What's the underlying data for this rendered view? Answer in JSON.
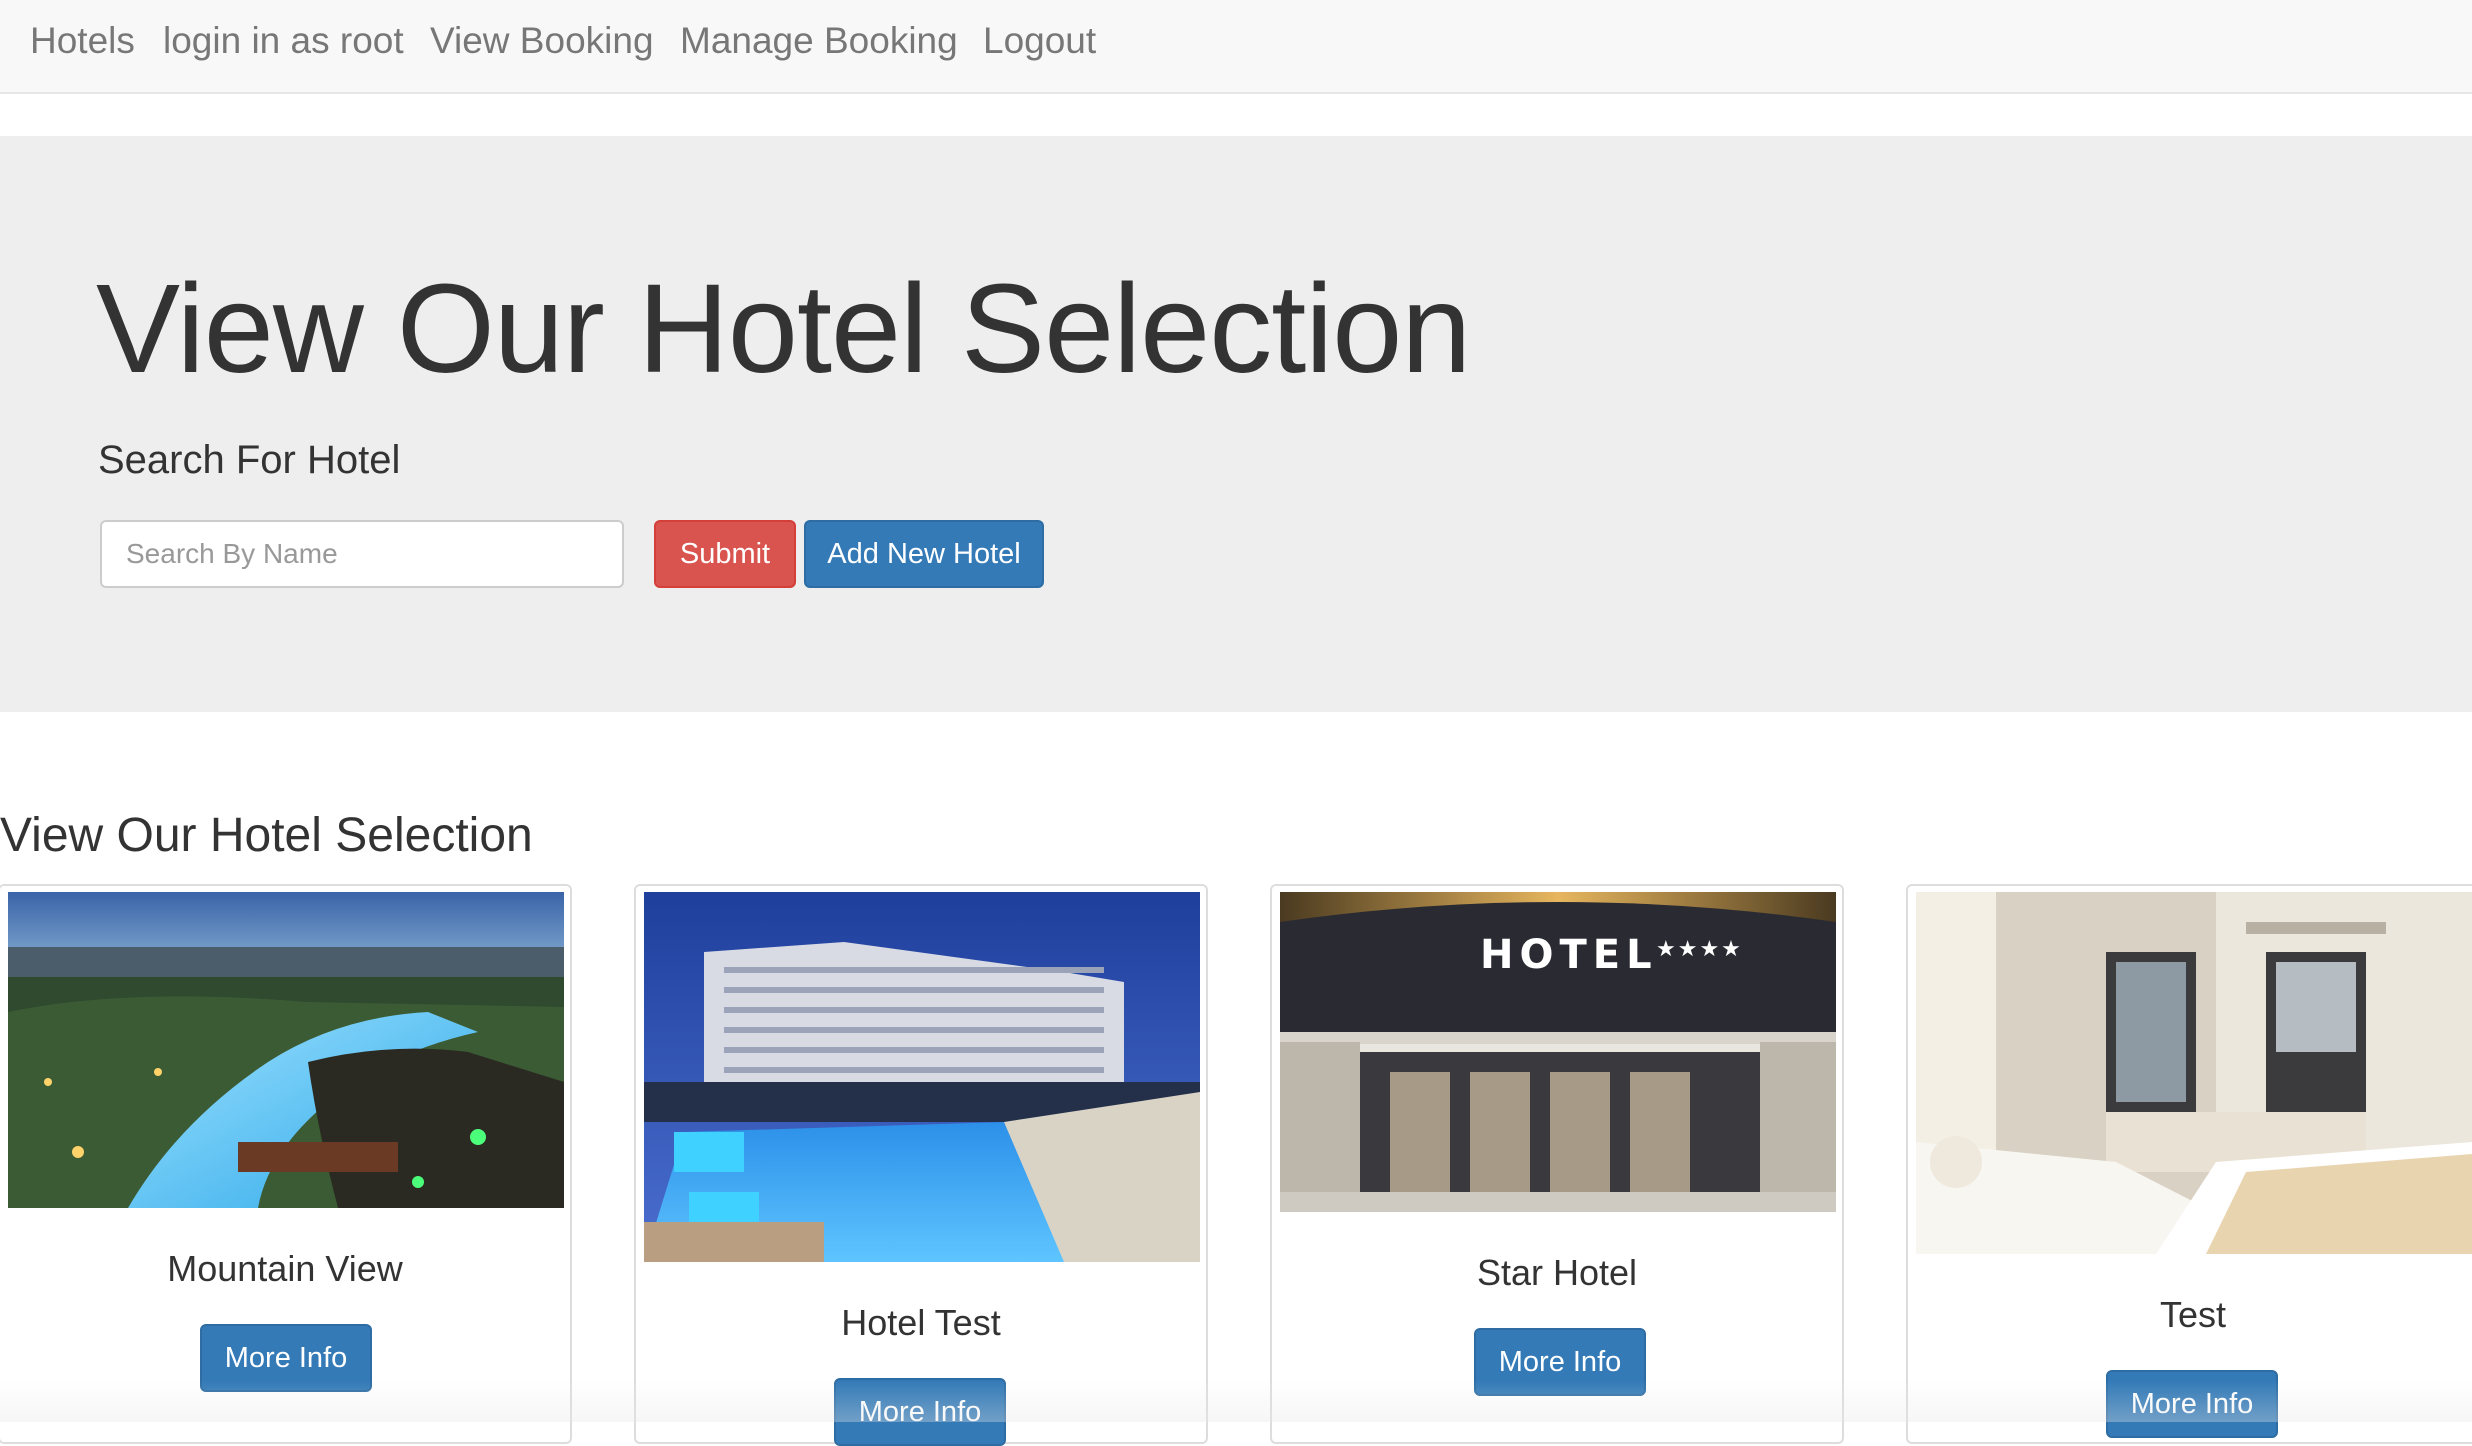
{
  "navbar": {
    "brand": "Hotels",
    "links": [
      "login in as root",
      "View Booking",
      "Manage Booking",
      "Logout"
    ]
  },
  "jumbotron": {
    "title": "View Our Hotel Selection",
    "subtitle": "Search For Hotel",
    "search_placeholder": "Search By Name",
    "submit_label": "Submit",
    "add_label": "Add New Hotel"
  },
  "section": {
    "title": "View Our Hotel Selection"
  },
  "hotels": [
    {
      "name": "Mountain View",
      "button": "More Info"
    },
    {
      "name": "Hotel Test",
      "button": "More Info"
    },
    {
      "name": "Star Hotel",
      "button": "More Info"
    },
    {
      "name": "Test",
      "button": "More Info"
    }
  ],
  "hotel_sign": {
    "text": "HOTEL",
    "stars": "★★★★"
  },
  "colors": {
    "primary": "#337ab7",
    "danger": "#d9534f",
    "jumbotron_bg": "#eeeeee",
    "navbar_bg": "#f8f8f8"
  }
}
